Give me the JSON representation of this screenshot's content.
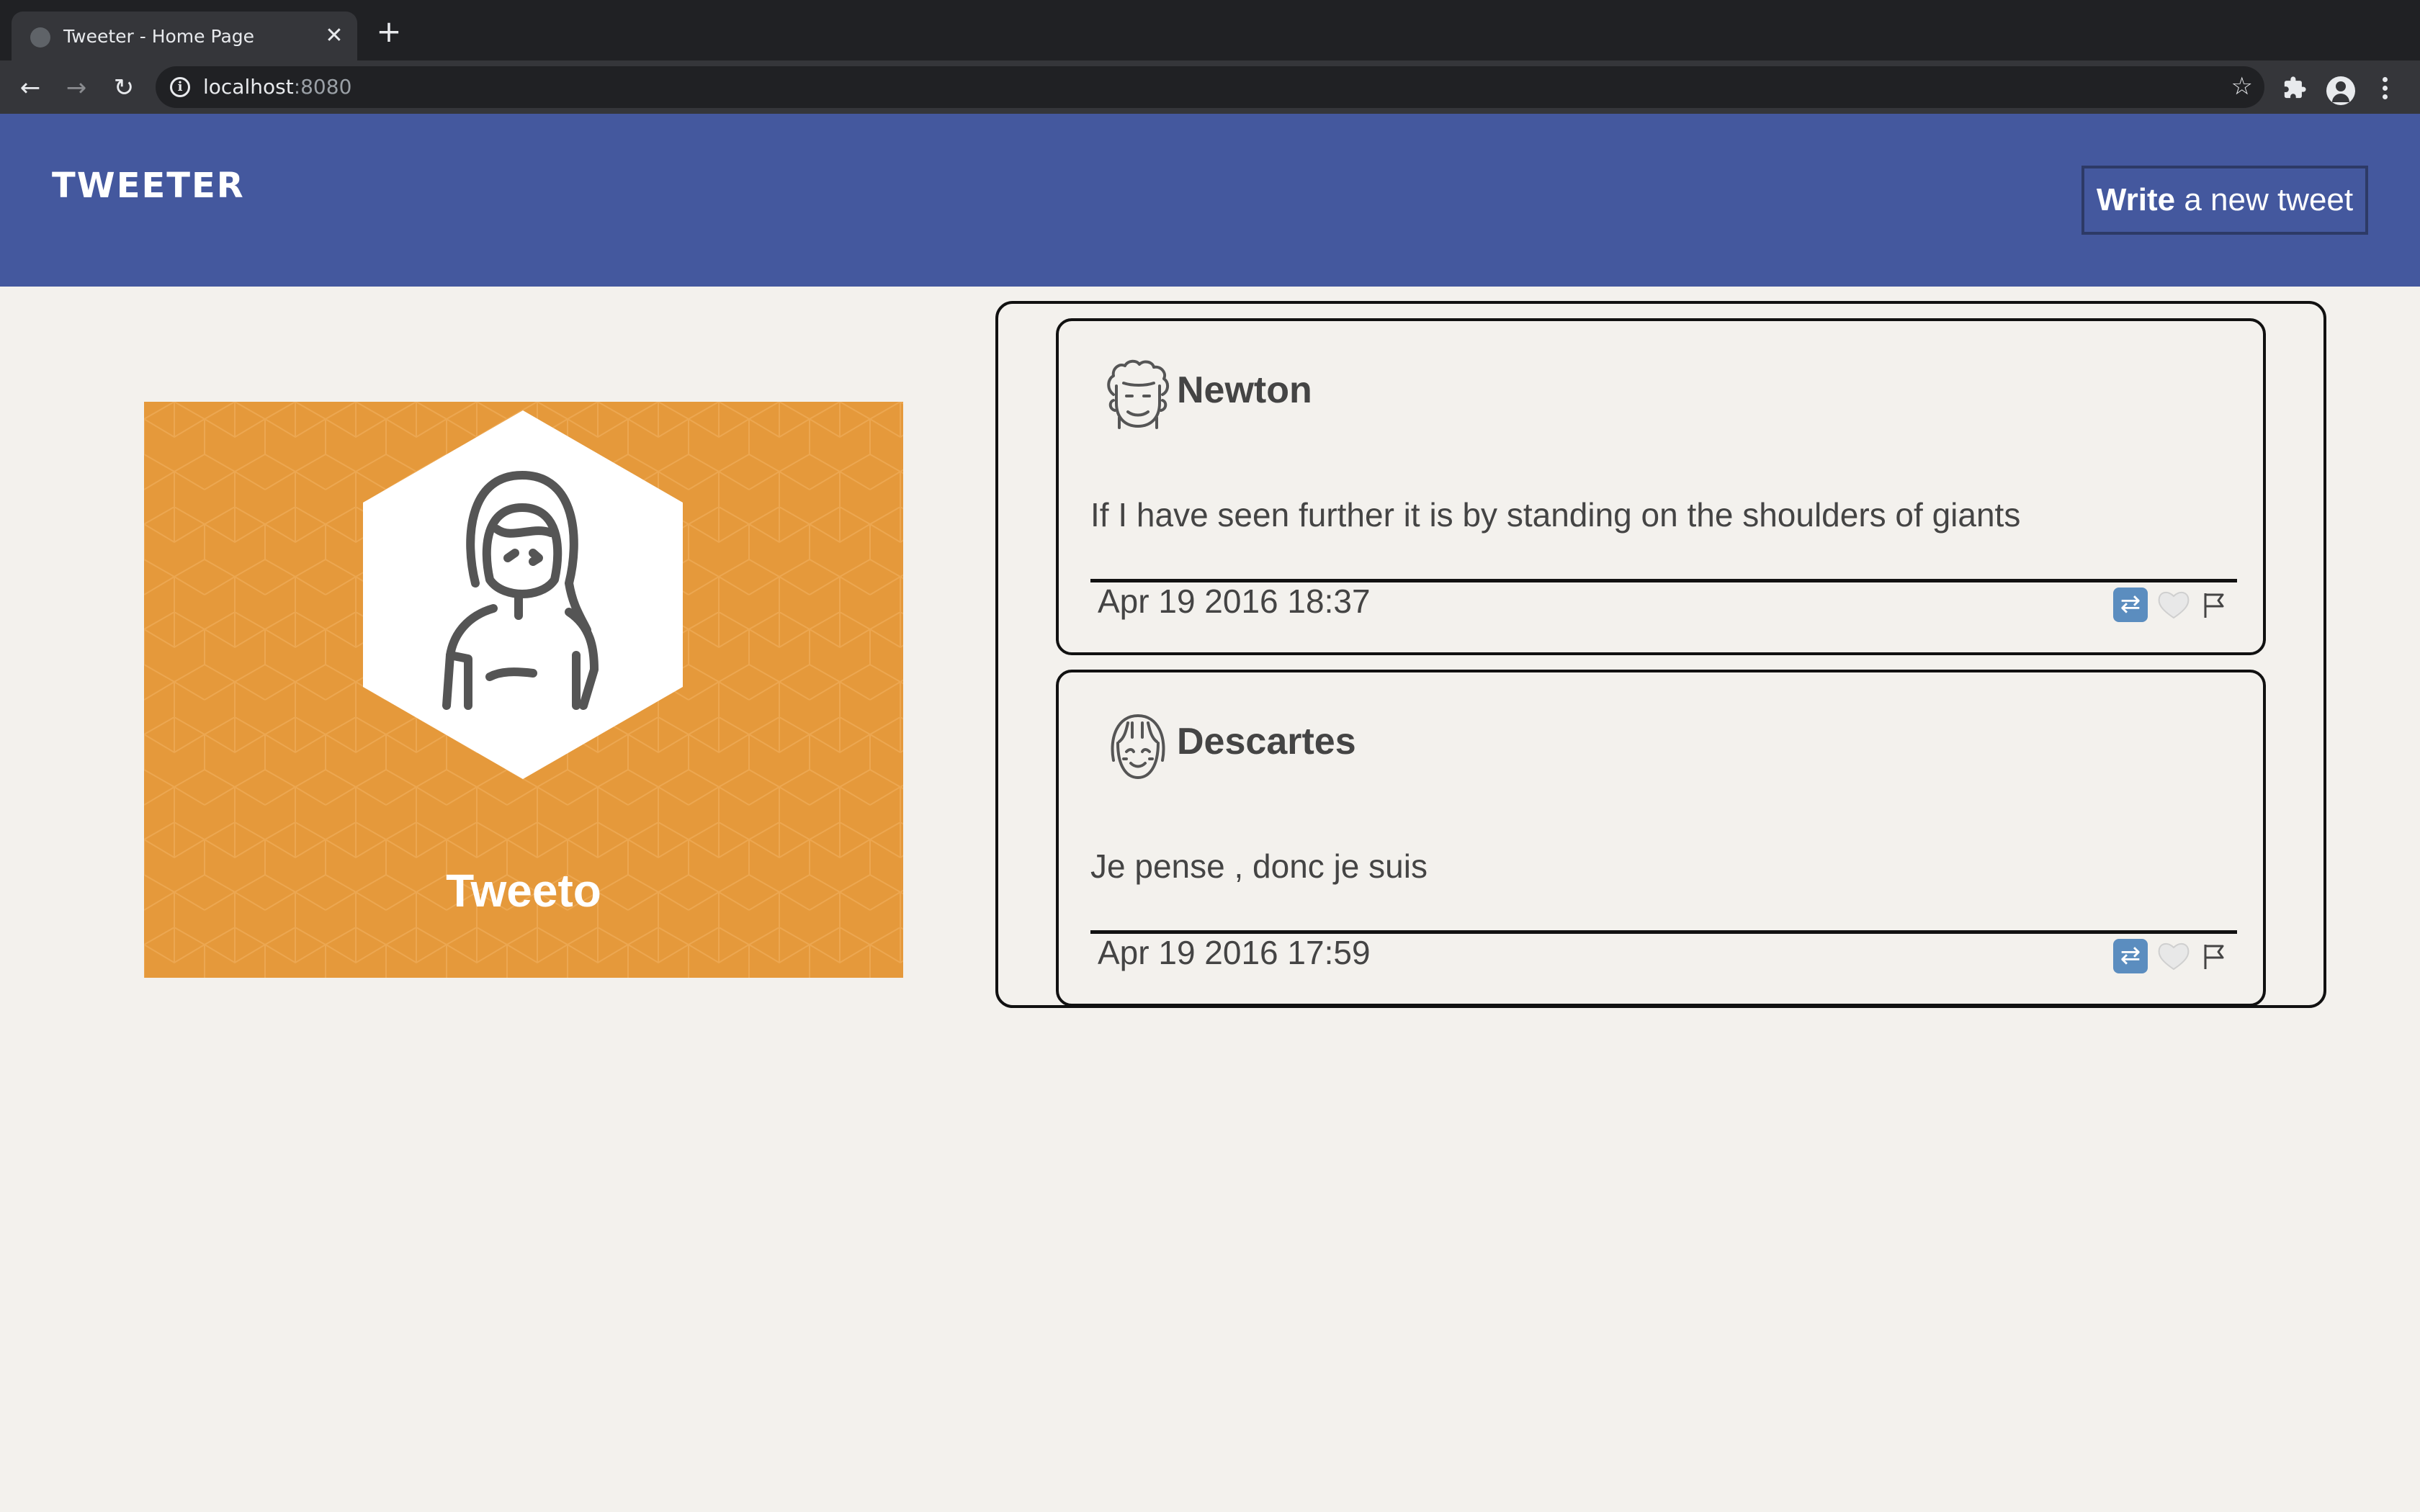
{
  "browser": {
    "tab_title": "Tweeter - Home Page",
    "tab_close": "✕",
    "new_tab": "+",
    "url_host": "localhost",
    "url_port": ":8080",
    "icons": [
      "globe-icon",
      "close-icon",
      "plus-icon",
      "back-icon",
      "forward-icon",
      "reload-icon",
      "info-icon",
      "star-icon",
      "extensions-icon",
      "profile-icon",
      "menu-icon"
    ]
  },
  "header": {
    "logo": "TWEETER",
    "write_button_bold": "Write",
    "write_button_rest": " a new tweet",
    "background_color": "#44589e"
  },
  "profile": {
    "name": "Tweeto",
    "card_color": "#e5993b"
  },
  "tweets": [
    {
      "author": "Newton",
      "text": "If I have seen further it is by standing on the shoulders of giants",
      "date": "Apr 19 2016 18:37"
    },
    {
      "author": "Descartes",
      "text": "Je pense , donc je suis",
      "date": "Apr 19 2016 17:59"
    }
  ]
}
